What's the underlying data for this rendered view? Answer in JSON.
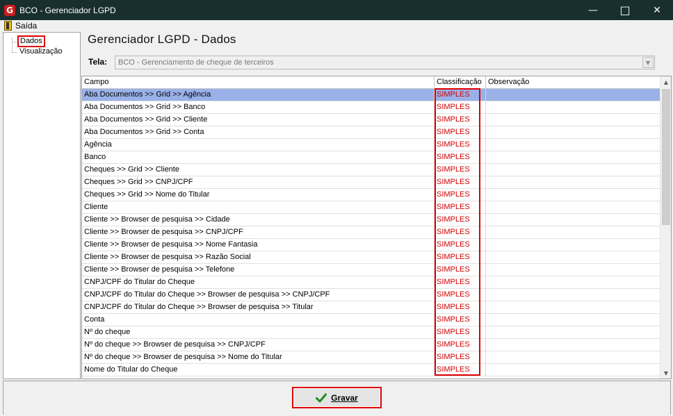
{
  "window": {
    "title": "BCO - Gerenciador LGPD",
    "logo_letter": "G",
    "minimize_glyph": "—",
    "maximize_glyph": "□",
    "close_glyph": "✕"
  },
  "menu": {
    "exit_label": "Saída"
  },
  "tree": {
    "items": [
      {
        "label": "Dados",
        "selected": true
      },
      {
        "label": "Visualização",
        "selected": false
      }
    ]
  },
  "header": {
    "title": "Gerenciador LGPD - Dados",
    "screen_label": "Tela:",
    "screen_value": "BCO - Gerenciamento de cheque de terceiros"
  },
  "grid": {
    "columns": [
      "Campo",
      "Classificação",
      "Observação"
    ],
    "rows": [
      {
        "campo": "Aba Documentos >> Grid >> Agência",
        "classificacao": "SIMPLES",
        "observacao": ""
      },
      {
        "campo": "Aba Documentos >> Grid >> Banco",
        "classificacao": "SIMPLES",
        "observacao": ""
      },
      {
        "campo": "Aba Documentos >> Grid >> Cliente",
        "classificacao": "SIMPLES",
        "observacao": ""
      },
      {
        "campo": "Aba Documentos >> Grid >> Conta",
        "classificacao": "SIMPLES",
        "observacao": ""
      },
      {
        "campo": "Agência",
        "classificacao": "SIMPLES",
        "observacao": ""
      },
      {
        "campo": "Banco",
        "classificacao": "SIMPLES",
        "observacao": ""
      },
      {
        "campo": "Cheques >> Grid >> Cliente",
        "classificacao": "SIMPLES",
        "observacao": ""
      },
      {
        "campo": "Cheques >> Grid >> CNPJ/CPF",
        "classificacao": "SIMPLES",
        "observacao": ""
      },
      {
        "campo": "Cheques >> Grid >> Nome do Titular",
        "classificacao": "SIMPLES",
        "observacao": ""
      },
      {
        "campo": "Cliente",
        "classificacao": "SIMPLES",
        "observacao": ""
      },
      {
        "campo": "Cliente >> Browser de pesquisa >> Cidade",
        "classificacao": "SIMPLES",
        "observacao": ""
      },
      {
        "campo": "Cliente >> Browser de pesquisa >> CNPJ/CPF",
        "classificacao": "SIMPLES",
        "observacao": ""
      },
      {
        "campo": "Cliente >> Browser de pesquisa >> Nome Fantasia",
        "classificacao": "SIMPLES",
        "observacao": ""
      },
      {
        "campo": "Cliente >> Browser de pesquisa >> Razão Social",
        "classificacao": "SIMPLES",
        "observacao": ""
      },
      {
        "campo": "Cliente >> Browser de pesquisa >> Telefone",
        "classificacao": "SIMPLES",
        "observacao": ""
      },
      {
        "campo": "CNPJ/CPF do Titular do Cheque",
        "classificacao": "SIMPLES",
        "observacao": ""
      },
      {
        "campo": "CNPJ/CPF do Titular do Cheque >> Browser de pesquisa >> CNPJ/CPF",
        "classificacao": "SIMPLES",
        "observacao": ""
      },
      {
        "campo": "CNPJ/CPF do Titular do Cheque >> Browser de pesquisa >> Titular",
        "classificacao": "SIMPLES",
        "observacao": ""
      },
      {
        "campo": "Conta",
        "classificacao": "SIMPLES",
        "observacao": ""
      },
      {
        "campo": "Nº do cheque",
        "classificacao": "SIMPLES",
        "observacao": ""
      },
      {
        "campo": "Nº do cheque >> Browser de pesquisa >> CNPJ/CPF",
        "classificacao": "SIMPLES",
        "observacao": ""
      },
      {
        "campo": "Nº do cheque >> Browser de pesquisa >> Nome do Titular",
        "classificacao": "SIMPLES",
        "observacao": ""
      },
      {
        "campo": "Nome do Titular do Cheque",
        "classificacao": "SIMPLES",
        "observacao": ""
      }
    ],
    "selected_row": 0
  },
  "footer": {
    "save_label": "Gravar"
  },
  "colors": {
    "titlebar": "#192f2f",
    "selection": "#9ab1e8",
    "classification_text": "#d40000",
    "highlight_box": "#e00000",
    "check_icon": "#1e8a1e"
  }
}
